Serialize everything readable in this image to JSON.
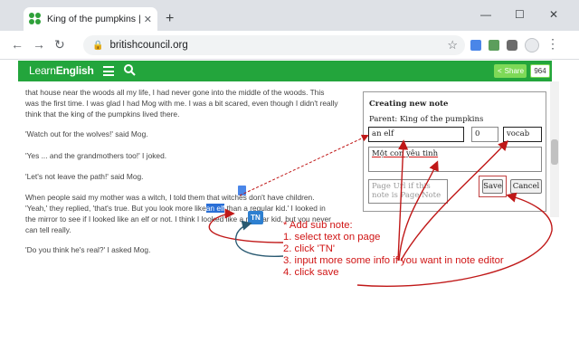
{
  "browser": {
    "tab_title": "King of the pumpkins | General English",
    "tab_close": "✕",
    "new_tab": "+",
    "window_controls": [
      "—",
      "☐",
      "✕"
    ],
    "nav": {
      "back": "←",
      "forward": "→",
      "reload": "↻"
    },
    "url": "britishcouncil.org",
    "lock_icon": "🔒",
    "star_icon": "☆",
    "menu_icon": "⋮"
  },
  "site": {
    "brand_light": "Learn",
    "brand_bold": "English",
    "share_label": "Share",
    "share_count": "964",
    "accent_color": "#23a53c"
  },
  "article": {
    "lines": [
      "that house near the woods all my life, I had never gone into the middle of the woods. This",
      "was the first time. I was glad I had Mog with me. I was a bit scared, even though I didn't really",
      "think that the king of the pumpkins lived there.",
      "'Watch out for the wolves!' said Mog.",
      "'Yes ... and the grandmothers too!' I joked.",
      "'Let's not leave the path!' said Mog.",
      "When people said my mother was a witch, I told them that witches don't have children.",
      "'Yeah,' they replied, 'that's true. But you look more like",
      "an elf",
      " than a regular kid.' I looked in",
      "the mirror to see if I looked like an elf or not. I think I looked like a regular kid, but you never",
      "can tell really.",
      "'Do you think he's real?' I asked Mog."
    ]
  },
  "note_editor": {
    "title": "Creating new note",
    "parent": "Parent: King of the pumpkins",
    "text_value": "an elf",
    "number_value": "0",
    "tag_value": "vocab",
    "meaning_value": "Một con yêu tinh",
    "url_placeholder": "Page Url if this note is Page Note",
    "save_label": "Save",
    "cancel_label": "Cancel"
  },
  "floating": {
    "tn_label": "TN"
  },
  "instructions": {
    "heading": "* Add sub note:",
    "steps": [
      "1. select text on page",
      "2. click 'TN'",
      "3. input more some info if you want in note editor",
      "4. click save"
    ],
    "color": "#d01515"
  }
}
